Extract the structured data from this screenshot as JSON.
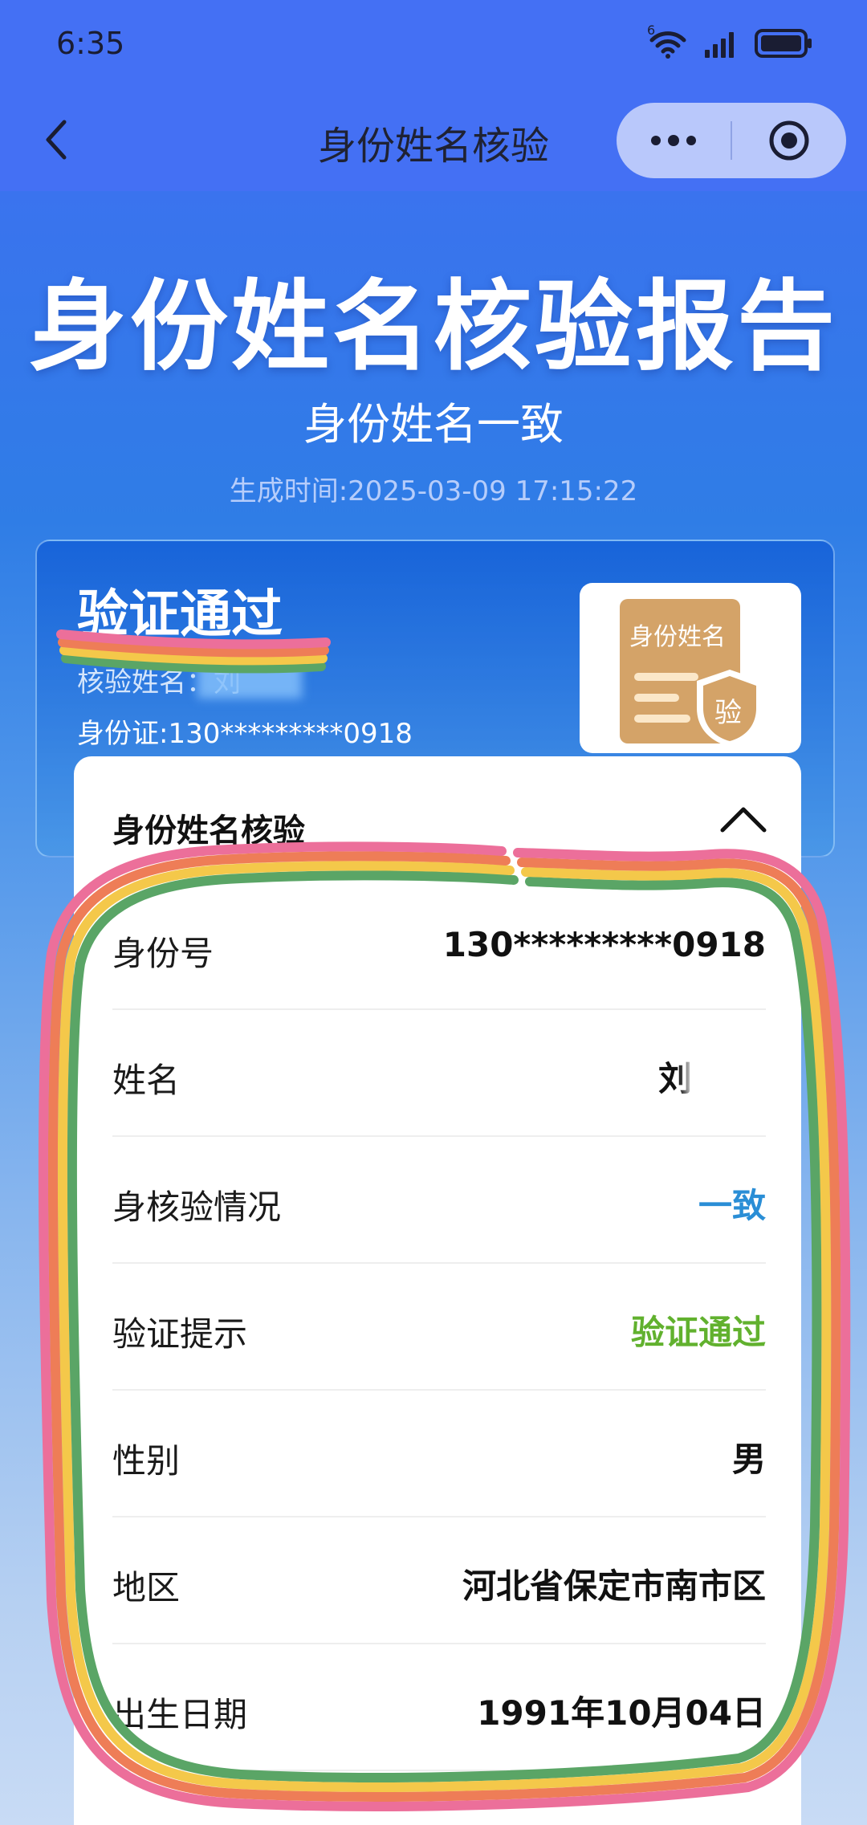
{
  "status_bar": {
    "time": "6:35",
    "network_label": "6"
  },
  "nav": {
    "title": "身份姓名核验"
  },
  "report": {
    "title": "身份姓名核验报告",
    "subtitle": "身份姓名一致",
    "generated_time": "生成时间:2025-03-09 17:15:22"
  },
  "result_card": {
    "status": "验证通过",
    "name_line": "核验姓名：刘",
    "id_line": "身份证:130*********0918",
    "badge_text": "身份姓名",
    "badge_seal": "验"
  },
  "details": {
    "header": "身份姓名核验",
    "rows": [
      {
        "label": "身份号",
        "value": "130*********0918"
      },
      {
        "label": "姓名",
        "value": "刘"
      },
      {
        "label": "身核验情况",
        "value": "一致"
      },
      {
        "label": "验证提示",
        "value": "验证通过"
      },
      {
        "label": "性别",
        "value": "男"
      },
      {
        "label": "地区",
        "value": "河北省保定市南市区"
      },
      {
        "label": "出生日期",
        "value": "1991年10月04日"
      }
    ]
  },
  "colors": {
    "nav_bg": "#4470f4",
    "consistent_value": "#2a8ed6",
    "passed_value": "#61b12e",
    "badge_paper": "#d4a368"
  },
  "icons": [
    "wifi-icon",
    "signal-icon",
    "battery-icon",
    "back-arrow-icon",
    "more-dots-icon",
    "target-icon",
    "chevron-up-icon",
    "shield-icon"
  ]
}
